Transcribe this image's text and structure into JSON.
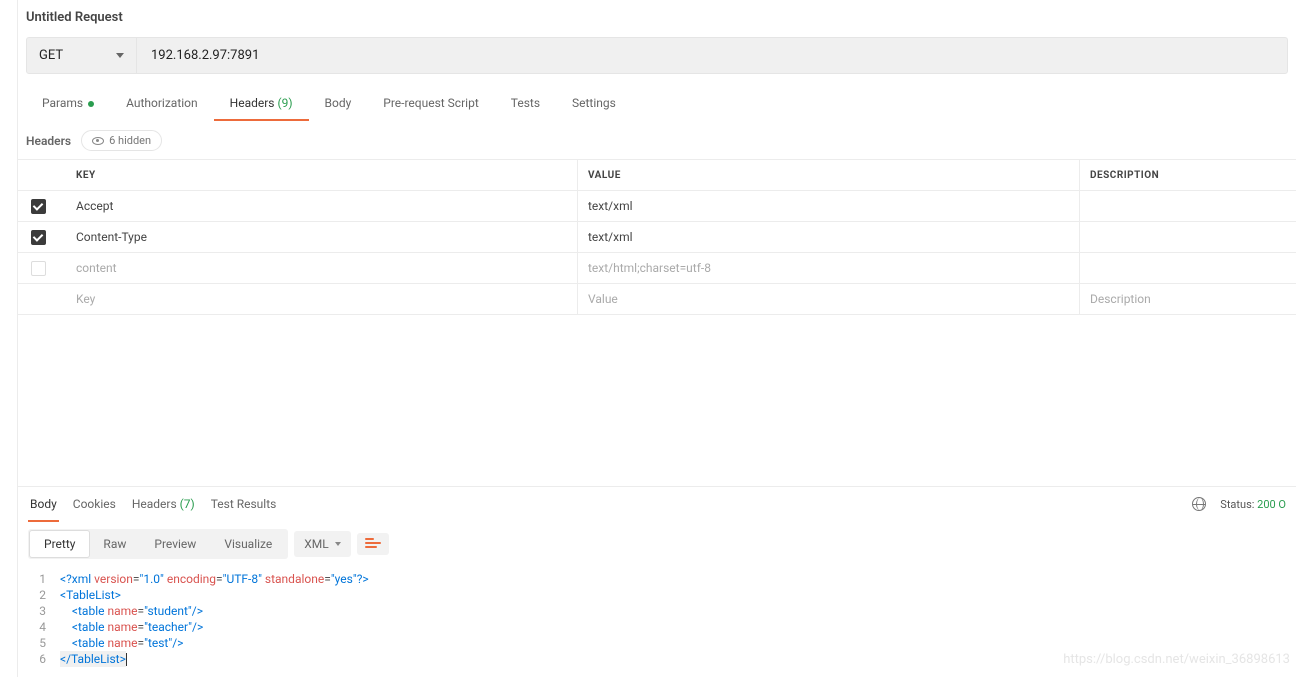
{
  "title": "Untitled Request",
  "method": {
    "label": "GET"
  },
  "url": "192.168.2.97:7891",
  "reqTabs": {
    "params": "Params",
    "auth": "Authorization",
    "headers": "Headers",
    "headersCount": "(9)",
    "body": "Body",
    "prereq": "Pre-request Script",
    "tests": "Tests",
    "settings": "Settings"
  },
  "headersSection": {
    "label": "Headers",
    "hidden": "6 hidden",
    "cols": {
      "key": "KEY",
      "value": "VALUE",
      "desc": "DESCRIPTION"
    },
    "rows": [
      {
        "checked": true,
        "key": "Accept",
        "value": "text/xml",
        "desc": ""
      },
      {
        "checked": true,
        "key": "Content-Type",
        "value": "text/xml",
        "desc": ""
      },
      {
        "checked": false,
        "key": "content",
        "value": "text/html;charset=utf-8",
        "desc": "",
        "placeholderish": true
      }
    ],
    "placeholderRow": {
      "key": "Key",
      "value": "Value",
      "desc": "Description"
    }
  },
  "respTabs": {
    "body": "Body",
    "cookies": "Cookies",
    "headers": "Headers",
    "headersCount": "(7)",
    "testResults": "Test Results"
  },
  "status": {
    "label": "Status:",
    "code": "200 O"
  },
  "viewBar": {
    "pretty": "Pretty",
    "raw": "Raw",
    "preview": "Preview",
    "visualize": "Visualize",
    "format": "XML"
  },
  "code": {
    "l1": {
      "a": "<?xml ",
      "vk": "version",
      "vv": "\"1.0\"",
      "ek": "encoding",
      "ev": "\"UTF-8\"",
      "sk": "standalone",
      "sv": "\"yes\"",
      "z": "?>"
    },
    "l2": "<TableList>",
    "l3": {
      "open": "<table ",
      "ak": "name",
      "av": "\"student\"",
      "close": "/>"
    },
    "l4": {
      "open": "<table ",
      "ak": "name",
      "av": "\"teacher\"",
      "close": "/>"
    },
    "l5": {
      "open": "<table ",
      "ak": "name",
      "av": "\"test\"",
      "close": "/>"
    },
    "l6": "</TableList>"
  },
  "watermark": "https://blog.csdn.net/weixin_36898613"
}
